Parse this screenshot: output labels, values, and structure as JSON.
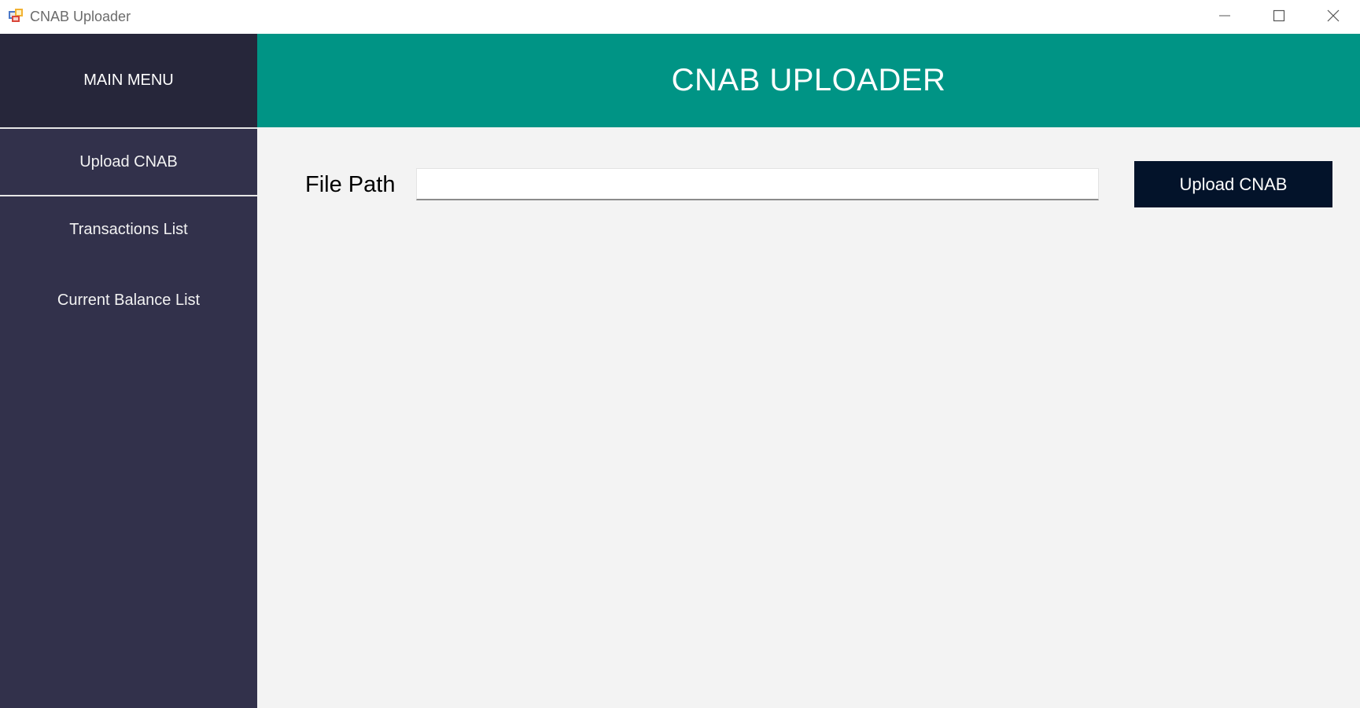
{
  "window": {
    "title": "CNAB Uploader",
    "controls": {
      "minimize_icon": "minimize-icon",
      "maximize_icon": "maximize-icon",
      "close_icon": "close-icon"
    }
  },
  "sidebar": {
    "header": "MAIN MENU",
    "items": [
      {
        "label": "Upload CNAB",
        "active": true
      },
      {
        "label": "Transactions List",
        "active": false
      },
      {
        "label": "Current Balance List",
        "active": false
      }
    ],
    "colors": {
      "background": "#32314b",
      "header_background": "#26263a"
    }
  },
  "header": {
    "title": "CNAB UPLOADER",
    "color": "#009485"
  },
  "main": {
    "file_path_label": "File Path",
    "file_path_value": "",
    "file_path_placeholder": "",
    "upload_button_label": "Upload CNAB",
    "upload_button_color": "#03132a"
  }
}
